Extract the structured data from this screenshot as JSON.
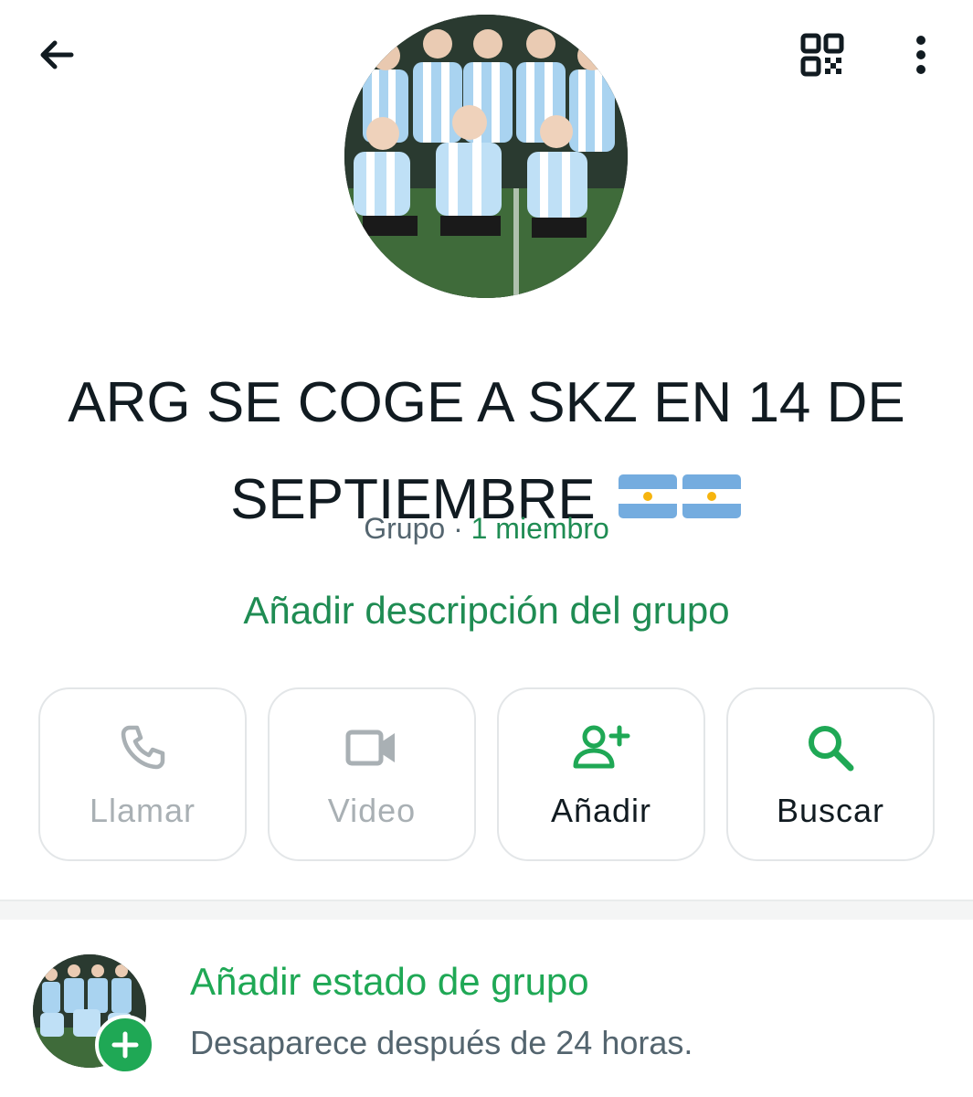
{
  "header": {
    "back_icon": "arrow-left-icon",
    "qr_icon": "qr-code-icon",
    "more_icon": "more-vertical-icon"
  },
  "group": {
    "title": "ARG SE COGE A SKZ EN 14 DE SEPTIEMBRE",
    "title_emoji": "flag-argentina-icon x2",
    "type_label": "Grupo",
    "separator": "·",
    "members_label": "1 miembro",
    "add_description": "Añadir descripción del grupo"
  },
  "actions": [
    {
      "label": "Llamar",
      "icon": "phone-icon",
      "enabled": false
    },
    {
      "label": "Video",
      "icon": "video-camera-icon",
      "enabled": false
    },
    {
      "label": "Añadir",
      "icon": "add-person-icon",
      "enabled": true
    },
    {
      "label": "Buscar",
      "icon": "search-icon",
      "enabled": true
    }
  ],
  "status": {
    "title": "Añadir estado de grupo",
    "subtitle": "Desaparece después de 24 horas."
  },
  "colors": {
    "accent_green": "#1fa855",
    "link_green": "#1f8c53",
    "text_primary": "#111b21",
    "text_secondary": "#54656f",
    "disabled": "#a9b0b4"
  }
}
